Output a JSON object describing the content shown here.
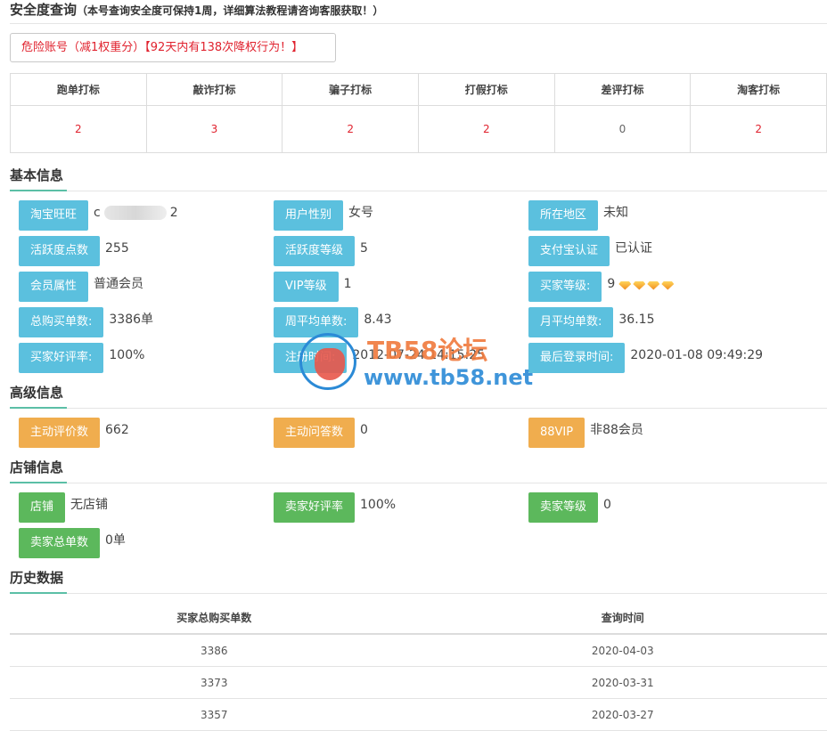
{
  "header": {
    "title": "安全度查询",
    "note": "（本号查询安全度可保持1周，详细算法教程请咨询客服获取！）"
  },
  "risk_notice": "危险账号（减1权重分）【92天内有138次降权行为！】",
  "flags": {
    "headers": [
      "跑单打标",
      "敲诈打标",
      "骗子打标",
      "打假打标",
      "差评打标",
      "淘客打标"
    ],
    "values": [
      "2",
      "3",
      "2",
      "2",
      "0",
      "2"
    ]
  },
  "basic": {
    "title": "基本信息",
    "fields": [
      {
        "label": "淘宝旺旺",
        "value_prefix": "c",
        "value_suffix": "2"
      },
      {
        "label": "用户性别",
        "value": "女号"
      },
      {
        "label": "所在地区",
        "value": "未知"
      },
      {
        "label": "活跃度点数",
        "value": "255"
      },
      {
        "label": "活跃度等级",
        "value": "5"
      },
      {
        "label": "支付宝认证",
        "value": "已认证"
      },
      {
        "label": "会员属性",
        "value": "普通会员"
      },
      {
        "label": "VIP等级",
        "value": "1"
      },
      {
        "label": "买家等级:",
        "value": "9",
        "icon": "diamond-icon",
        "icon_count": 4
      },
      {
        "label": "总购买单数:",
        "value": "3386单"
      },
      {
        "label": "周平均单数:",
        "value": "8.43"
      },
      {
        "label": "月平均单数:",
        "value": "36.15"
      },
      {
        "label": "买家好评率:",
        "value": "100%"
      },
      {
        "label": "注册时间:",
        "value": "2012-07-24 14:15:25"
      },
      {
        "label": "最后登录时间:",
        "value": "2020-01-08 09:49:29"
      }
    ]
  },
  "advanced": {
    "title": "高级信息",
    "fields": [
      {
        "label": "主动评价数",
        "value": "662"
      },
      {
        "label": "主动问答数",
        "value": "0"
      },
      {
        "label": "88VIP",
        "value": "非88会员"
      }
    ]
  },
  "shop": {
    "title": "店铺信息",
    "fields": [
      {
        "label": "店铺",
        "value": "无店铺"
      },
      {
        "label": "卖家好评率",
        "value": "100%"
      },
      {
        "label": "卖家等级",
        "value": "0"
      },
      {
        "label": "卖家总单数",
        "value": "0单"
      }
    ]
  },
  "history": {
    "title": "历史数据",
    "columns": [
      "买家总购买单数",
      "查询时间"
    ],
    "rows": [
      [
        "3386",
        "2020-04-03"
      ],
      [
        "3373",
        "2020-03-31"
      ],
      [
        "3357",
        "2020-03-27"
      ]
    ]
  },
  "watermark": {
    "line1": "TB58论坛",
    "line2": "www.tb58.net"
  },
  "colors": {
    "tag_blue": "#5bc0de",
    "tag_orange": "#f0ad4e",
    "tag_green": "#5cb85c",
    "danger_red": "#e0222e",
    "section_underline": "#5bbfa6"
  }
}
